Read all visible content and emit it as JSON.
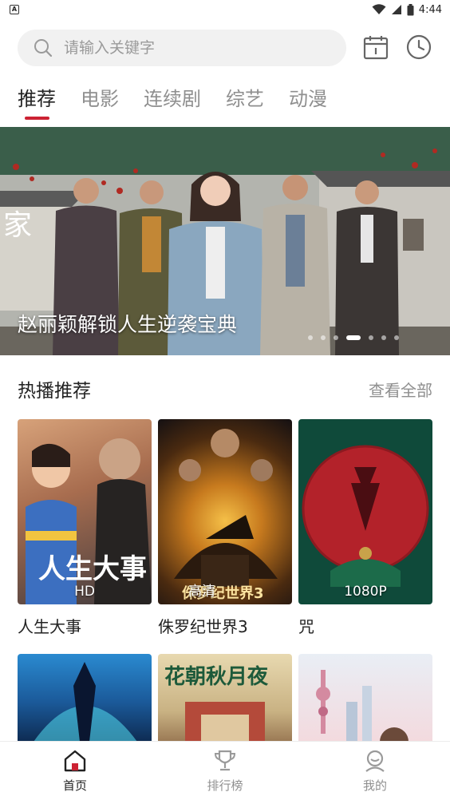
{
  "status_bar": {
    "time": "4:44",
    "app_badge": "A"
  },
  "search": {
    "placeholder": "请输入关键字"
  },
  "header_icons": {
    "calendar": "calendar-icon",
    "history": "clock-icon"
  },
  "tabs": [
    {
      "label": "推荐",
      "active": true
    },
    {
      "label": "电影",
      "active": false
    },
    {
      "label": "连续剧",
      "active": false
    },
    {
      "label": "综艺",
      "active": false
    },
    {
      "label": "动漫",
      "active": false
    }
  ],
  "banner": {
    "title": "赵丽颖解锁人生逆袭宝典",
    "overlay_text": "家",
    "slide_count": 8,
    "active_slide": 4
  },
  "section": {
    "title": "热播推荐",
    "more": "查看全部"
  },
  "movies": [
    {
      "title": "人生大事",
      "badge": "HD",
      "poster_text": "人生大事"
    },
    {
      "title": "侏罗纪世界3",
      "badge": "高清",
      "poster_text": "侏罗纪世界3"
    },
    {
      "title": "咒",
      "badge": "1080P",
      "poster_text": ""
    }
  ],
  "movies_row2": [
    {
      "poster_text": "花朝秋月夜"
    },
    {
      "poster_text": ""
    },
    {
      "poster_text": ""
    }
  ],
  "bottom_nav": [
    {
      "label": "首页",
      "icon": "home-icon",
      "active": true
    },
    {
      "label": "排行榜",
      "icon": "trophy-icon",
      "active": false
    },
    {
      "label": "我的",
      "icon": "profile-icon",
      "active": false
    }
  ],
  "colors": {
    "accent": "#cc2233",
    "tab_inactive": "#8f8f8f",
    "search_bg": "#f1f1f1"
  }
}
